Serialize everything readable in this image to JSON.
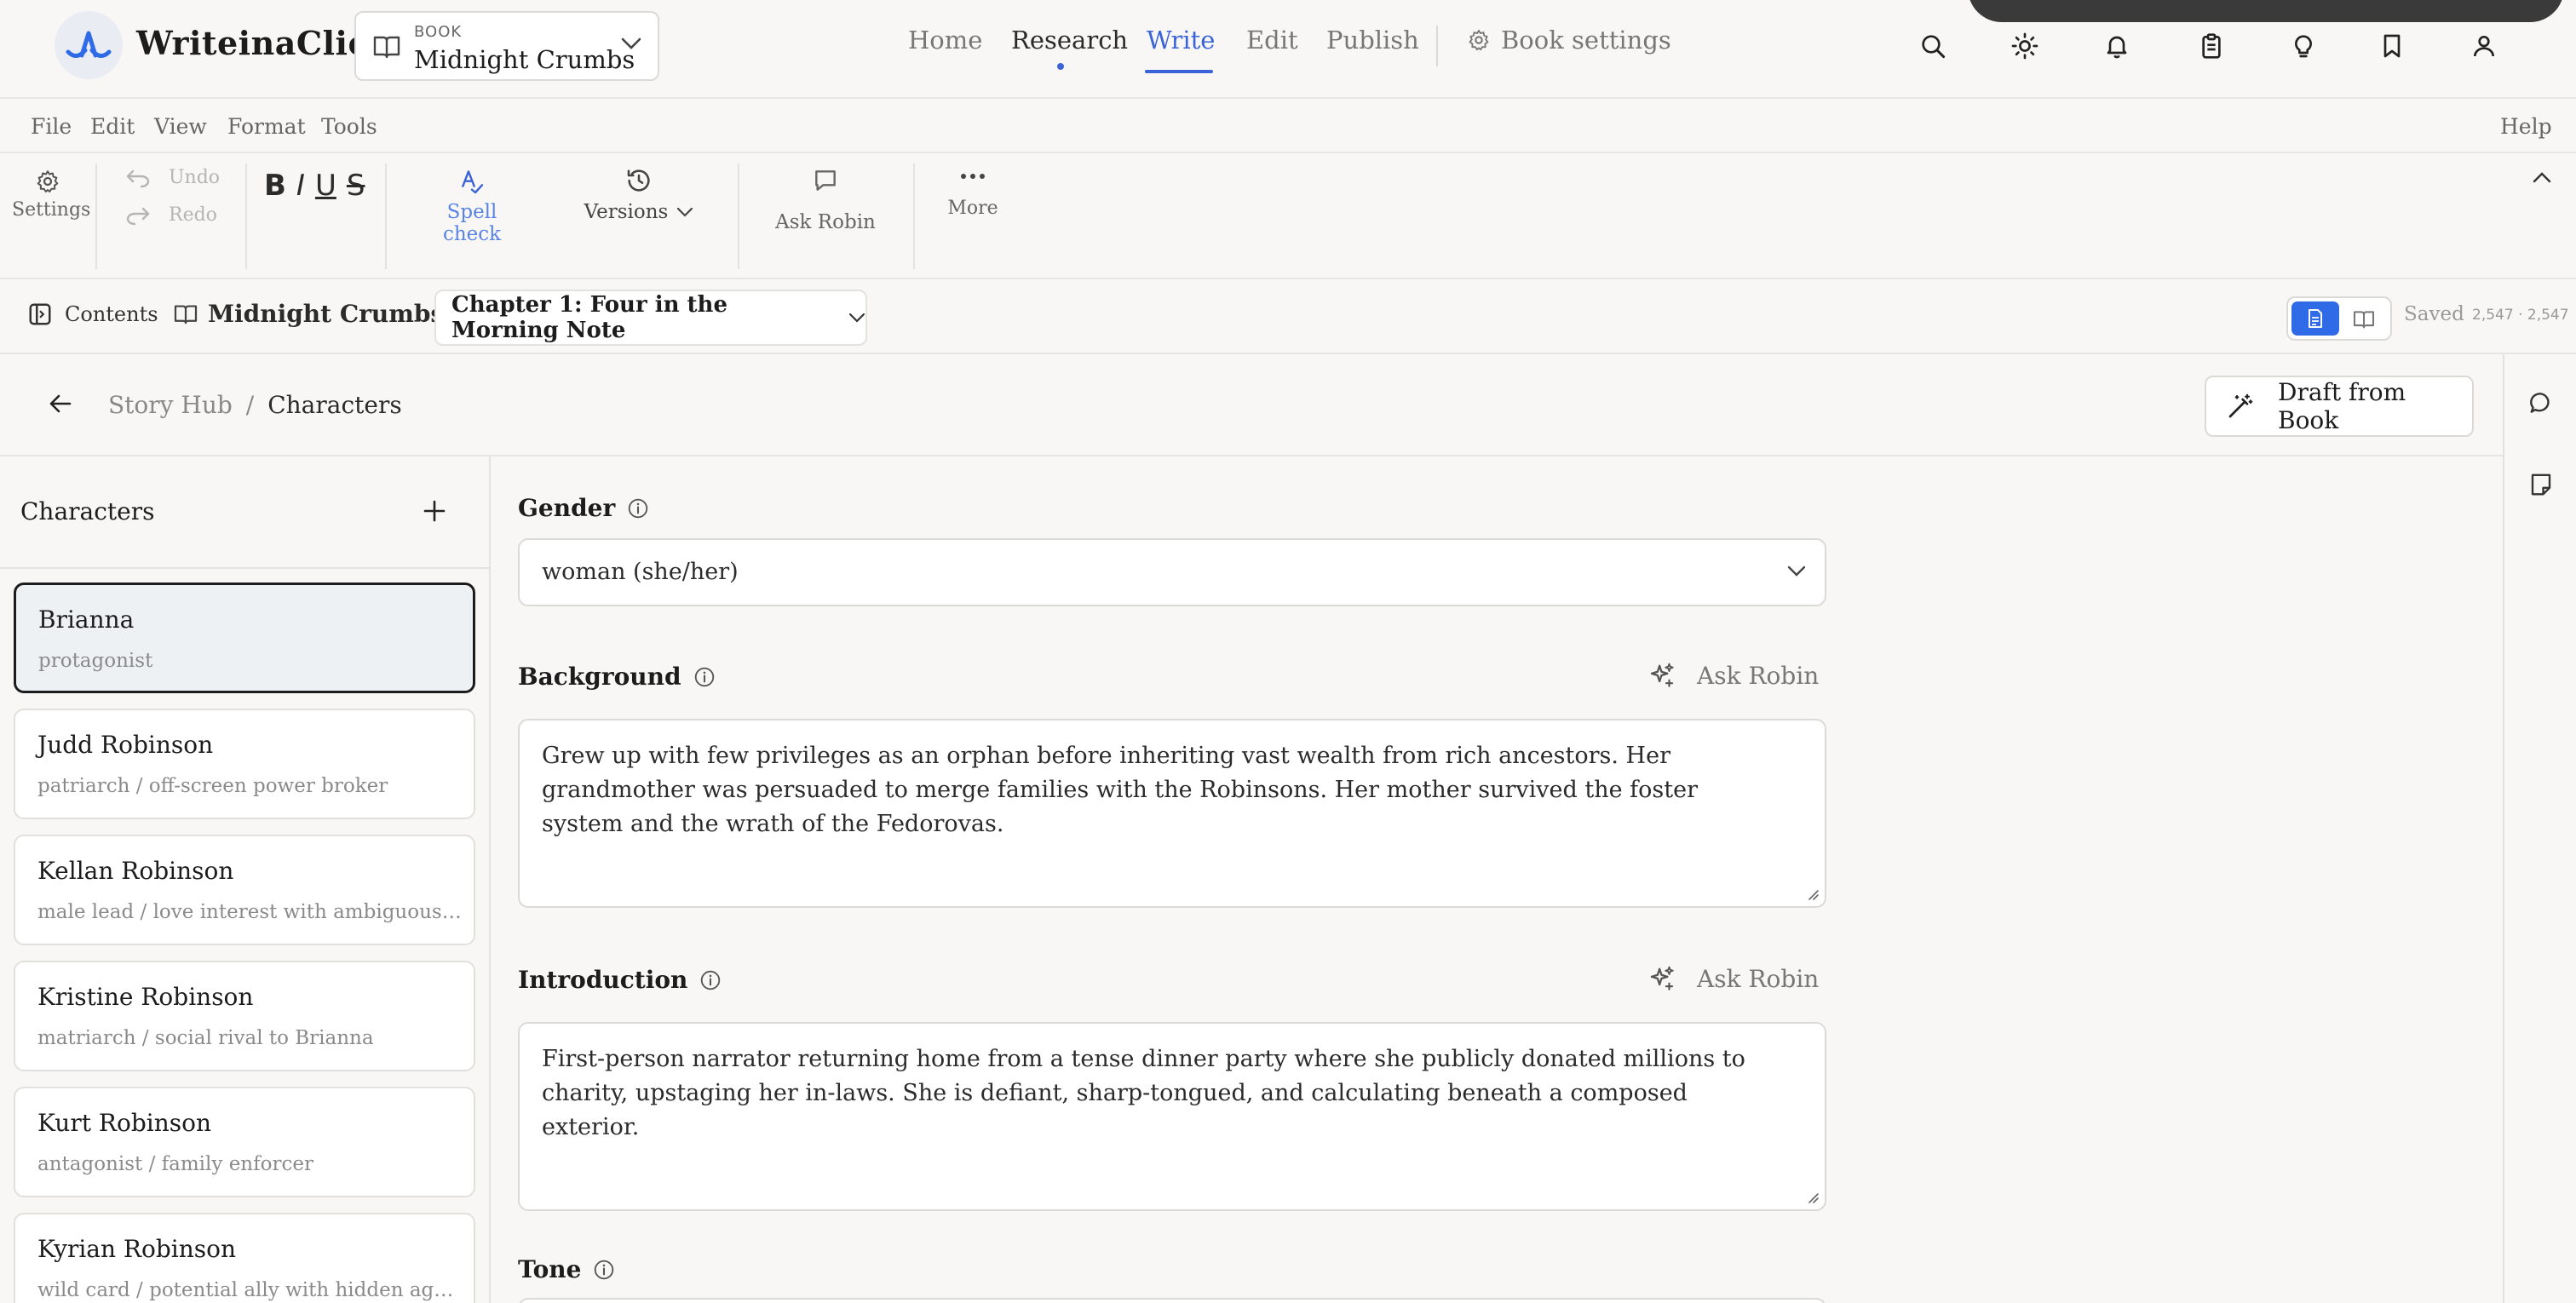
{
  "app": {
    "name": "WriteinaClick"
  },
  "book_picker": {
    "label": "BOOK",
    "name": "Midnight Crumbs"
  },
  "nav": {
    "home": "Home",
    "research": "Research",
    "write": "Write",
    "edit": "Edit",
    "publish": "Publish",
    "book_settings": "Book settings"
  },
  "menu": {
    "file": "File",
    "edit": "Edit",
    "view": "View",
    "format": "Format",
    "tools": "Tools",
    "help": "Help"
  },
  "toolbar": {
    "settings": "Settings",
    "undo": "Undo",
    "redo": "Redo",
    "bold": "B",
    "italic": "I",
    "underline": "U",
    "strike": "S",
    "spell_check": "Spell check",
    "versions": "Versions",
    "ask_robin": "Ask Robin",
    "more": "More"
  },
  "chapterbar": {
    "contents": "Contents",
    "book_title": "Midnight Crumbs",
    "chapter": "Chapter 1: Four in the Morning Note",
    "saved": "Saved",
    "word_count": "2,547 · 2,547"
  },
  "breadcrumb": {
    "root": "Story Hub",
    "separator": "/",
    "current": "Characters"
  },
  "draft_button": "Draft from Book",
  "characters": {
    "title": "Characters",
    "items": [
      {
        "name": "Brianna",
        "role": "protagonist",
        "active": true
      },
      {
        "name": "Judd Robinson",
        "role": "patriarch / off-screen power broker"
      },
      {
        "name": "Kellan Robinson",
        "role": "male lead / love interest with ambiguous loyalties"
      },
      {
        "name": "Kristine Robinson",
        "role": "matriarch / social rival to Brianna"
      },
      {
        "name": "Kurt Robinson",
        "role": "antagonist / family enforcer"
      },
      {
        "name": "Kyrian Robinson",
        "role": "wild card / potential ally with hidden agenda"
      }
    ]
  },
  "form": {
    "gender": {
      "label": "Gender",
      "value": "woman (she/her)"
    },
    "background": {
      "label": "Background",
      "ask": "Ask Robin",
      "value": "Grew up with few privileges as an orphan before inheriting vast wealth from rich ancestors. Her grandmother was persuaded to merge families with the Robinsons. Her mother survived the foster system and the wrath of the Fedorovas."
    },
    "introduction": {
      "label": "Introduction",
      "ask": "Ask Robin",
      "value": "First-person narrator returning home from a tense dinner party where she publicly donated millions to charity, upstaging her in-laws. She is defiant, sharp-tongued, and calculating beneath a composed exterior."
    },
    "tone": {
      "label": "Tone"
    }
  },
  "colors": {
    "accent": "#3b63d8",
    "toggle_active": "#2f6be6"
  }
}
